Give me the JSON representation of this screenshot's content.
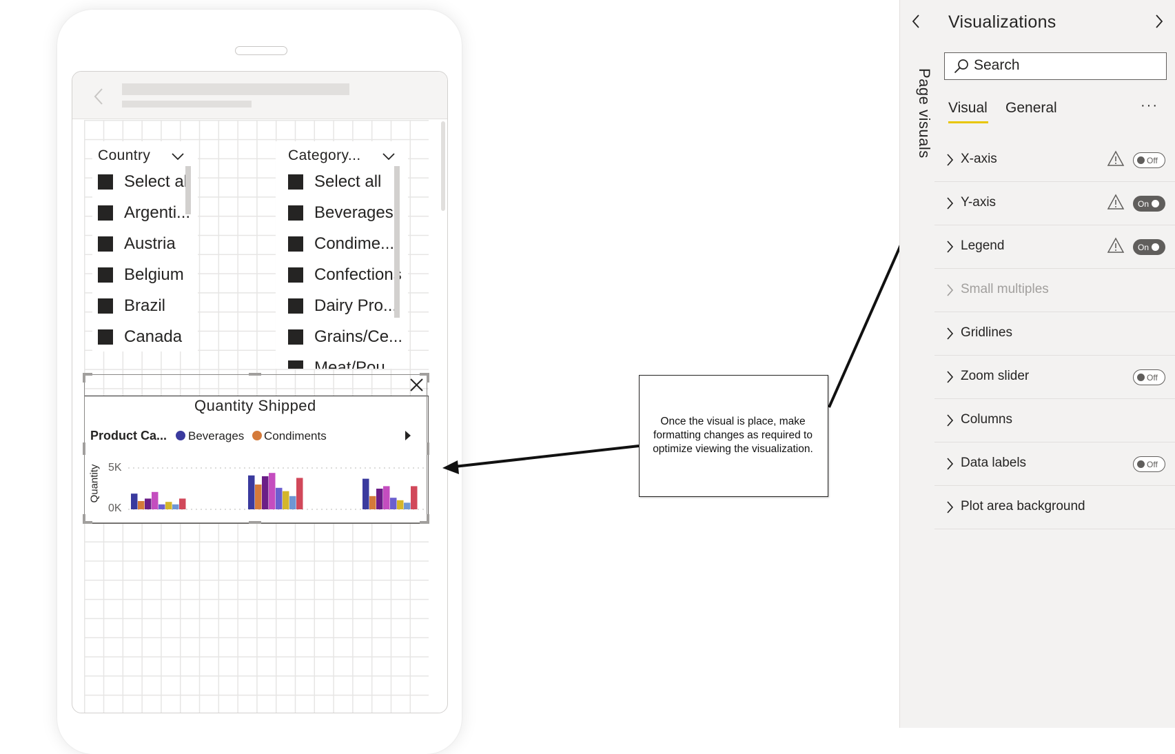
{
  "phone": {
    "slicers": [
      {
        "title": "Country",
        "items": [
          "Select all",
          "Argenti...",
          "Austria",
          "Belgium",
          "Brazil",
          "Canada"
        ]
      },
      {
        "title": "Category...",
        "items": [
          "Select all",
          "Beverages",
          "Condime...",
          "Confections",
          "Dairy Pro...",
          "Grains/Ce...",
          "Meat/Pou..."
        ]
      }
    ]
  },
  "chart_data": {
    "type": "bar",
    "title": "Quantity Shipped",
    "legend_title": "Product Ca...",
    "legend": [
      {
        "name": "Beverages",
        "color": "#3a3a9e"
      },
      {
        "name": "Condiments",
        "color": "#d47a3a"
      }
    ],
    "ylabel": "Quantity",
    "yticks": [
      "5K",
      "0K"
    ],
    "ylim": [
      0,
      6000
    ],
    "colors": [
      "#3a3a9e",
      "#d47a3a",
      "#6b1e87",
      "#c44dbf",
      "#6b5fcf",
      "#d4b62b",
      "#6f96d4",
      "#d1485a"
    ],
    "groups": [
      [
        1900,
        1000,
        1300,
        2100,
        600,
        900,
        600,
        1300
      ],
      [
        4100,
        3000,
        4000,
        4400,
        2600,
        2200,
        1600,
        3800
      ],
      [
        3700,
        1600,
        2500,
        2800,
        1400,
        1100,
        800,
        2800
      ]
    ]
  },
  "callout": {
    "lines": [
      "Once the visual is place, make",
      "formatting changes as required to",
      "optimize viewing the visualization."
    ]
  },
  "page_visuals": {
    "label": "Page visuals"
  },
  "visualizations": {
    "title": "Visualizations",
    "search_placeholder": "Search",
    "tabs": [
      "Visual",
      "General"
    ],
    "more_label": "···",
    "rows": [
      {
        "label": "X-axis",
        "warning": true,
        "toggle": "Off"
      },
      {
        "label": "Y-axis",
        "warning": true,
        "toggle": "On"
      },
      {
        "label": "Legend",
        "warning": true,
        "toggle": "On"
      },
      {
        "label": "Small multiples",
        "disabled": true
      },
      {
        "label": "Gridlines"
      },
      {
        "label": "Zoom slider",
        "toggle": "Off"
      },
      {
        "label": "Columns"
      },
      {
        "label": "Data labels",
        "toggle": "Off"
      },
      {
        "label": "Plot area background"
      }
    ]
  }
}
